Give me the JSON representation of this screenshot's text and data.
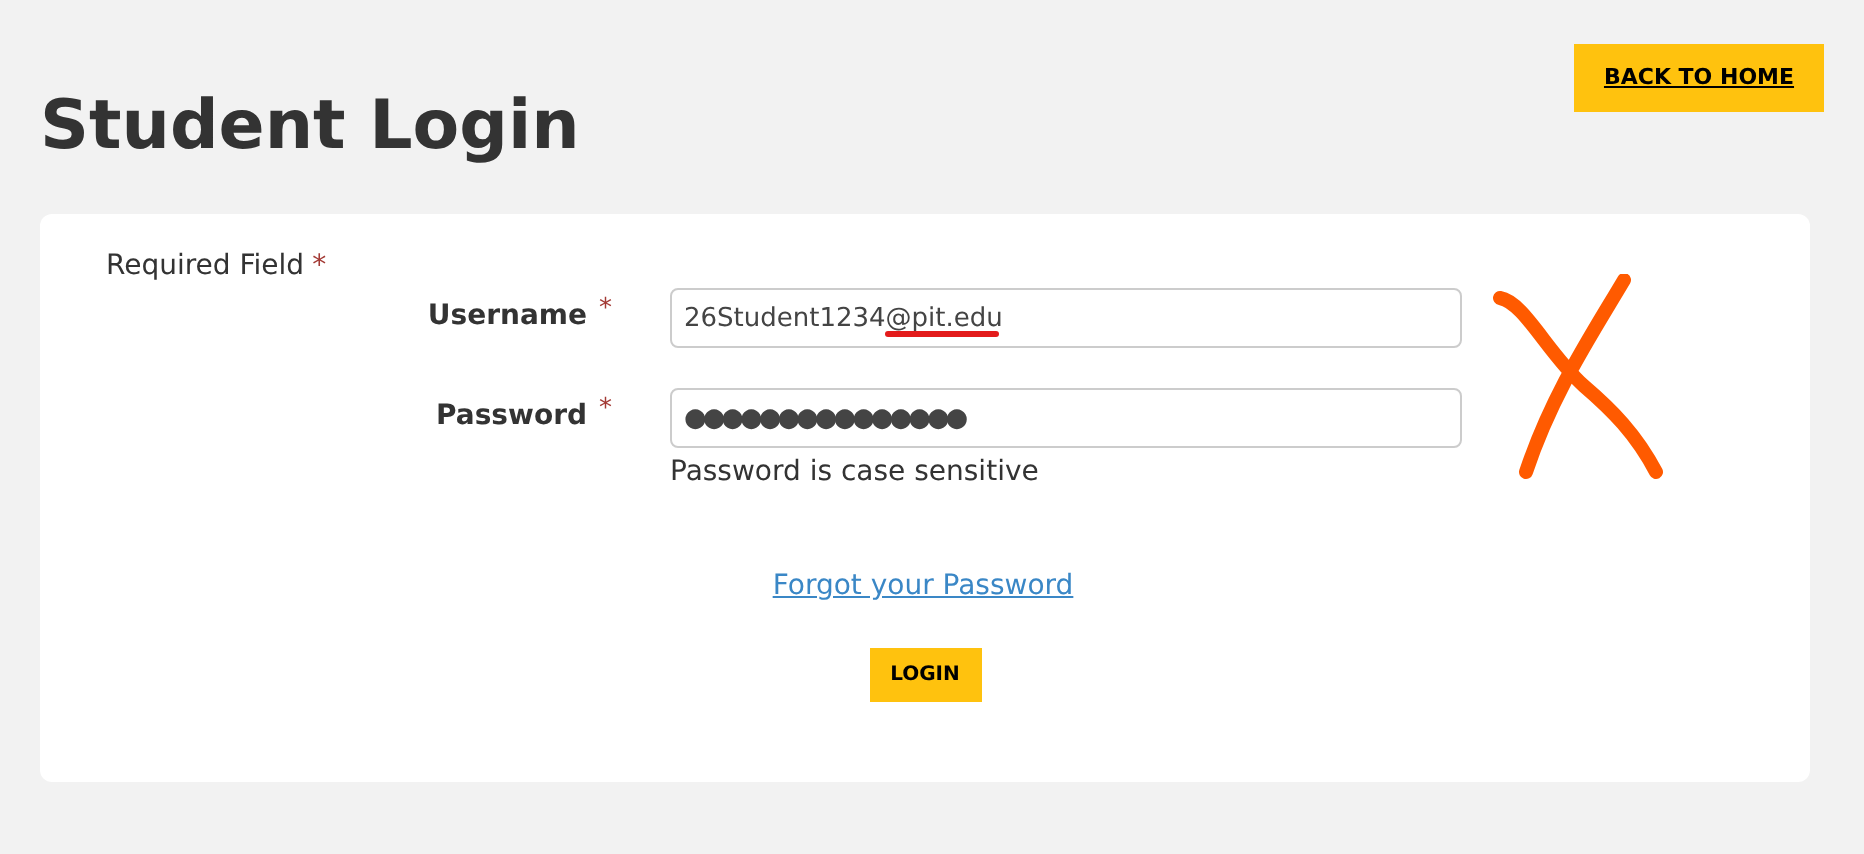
{
  "page": {
    "title": "Student Login",
    "back_button": "BACK TO HOME"
  },
  "form": {
    "required_note": "Required Field",
    "required_mark": "*",
    "fields": [
      {
        "label": "Username",
        "required": true,
        "value": "26Student1234@pit.edu"
      },
      {
        "label": "Password",
        "required": true,
        "value": "●●●●●●●●●●●●●●●",
        "hint": "Password is case sensitive"
      }
    ],
    "forgot_link": "Forgot your Password",
    "submit_button": "LOGIN"
  },
  "annotations": [
    {
      "kind": "underline",
      "color": "#e31b1b"
    },
    {
      "kind": "cross",
      "color": "#ff5a00"
    }
  ]
}
